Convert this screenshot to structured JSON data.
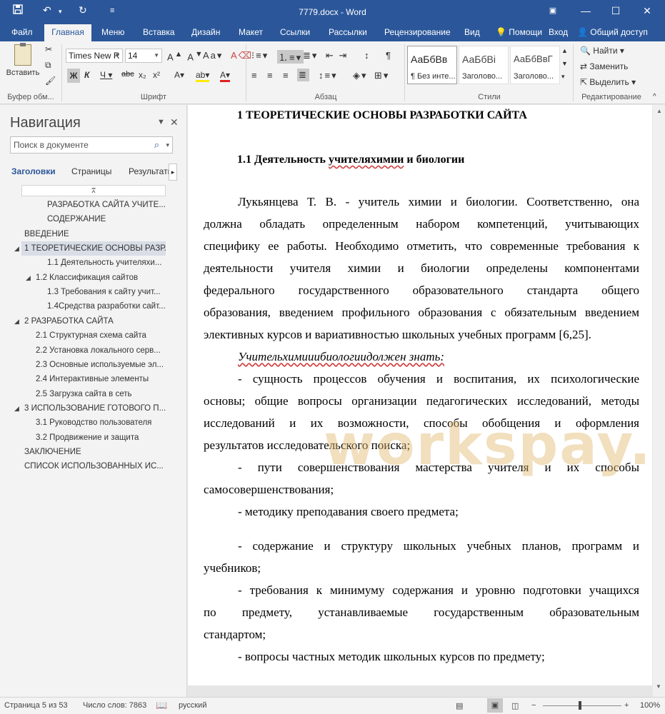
{
  "titlebar": {
    "title": "7779.docx - Word",
    "save_icon": "save-icon",
    "undo_icon": "undo-icon",
    "redo_icon": "redo-icon"
  },
  "tabs": {
    "items": [
      "Файл",
      "Главная",
      "Меню",
      "Вставка",
      "Дизайн",
      "Макет",
      "Ссылки",
      "Рассылки",
      "Рецензирование",
      "Вид"
    ],
    "active": "Главная",
    "help": "Помощи",
    "login": "Вход",
    "share": "Общий доступ"
  },
  "ribbon": {
    "paste_label": "Вставить",
    "clipboard_label": "Буфер обм...",
    "font_name": "Times New R",
    "font_size": "14",
    "font_group_label": "Шрифт",
    "paragraph_group_label": "Абзац",
    "styles_group_label": "Стили",
    "editing_group_label": "Редактирование",
    "styles": [
      {
        "sample": "АаБбВв",
        "name": "¶ Без инте..."
      },
      {
        "sample": "АаБбВі",
        "name": "Заголово..."
      },
      {
        "sample": "АаБбВвГ",
        "name": "Заголово..."
      }
    ],
    "find_label": "Найти",
    "replace_label": "Заменить",
    "select_label": "Выделить"
  },
  "nav": {
    "title": "Навигация",
    "search_placeholder": "Поиск в документе",
    "tabs": [
      "Заголовки",
      "Страницы",
      "Результаты"
    ],
    "items": [
      {
        "label": "РАЗРАБОТКА САЙТА УЧИТЕ...",
        "expanded": null
      },
      {
        "label": "СОДЕРЖАНИЕ",
        "expanded": null
      },
      {
        "label": "ВВЕДЕНИЕ",
        "expanded": null
      },
      {
        "label": "1 ТЕОРЕТИЧЕСКИЕ ОСНОВЫ РАЗР...",
        "expanded": true,
        "selected": true
      },
      {
        "label": "1.1 Деятельность учителяхи...",
        "expanded": null
      },
      {
        "label": "1.2 Классификация сайтов",
        "expanded": true
      },
      {
        "label": "1.3 Требования к сайту учит...",
        "expanded": null
      },
      {
        "label": "1.4Средства разработки сайт...",
        "expanded": null
      },
      {
        "label": "2 РАЗРАБОТКА САЙТА",
        "expanded": true
      },
      {
        "label": "2.1 Структурная схема сайта",
        "expanded": null
      },
      {
        "label": "2.2 Установка локального серв...",
        "expanded": null
      },
      {
        "label": "2.3 Основные используемые эл...",
        "expanded": null
      },
      {
        "label": "2.4 Интерактивные элементы",
        "expanded": null
      },
      {
        "label": "2.5 Загрузка сайта в сеть",
        "expanded": null
      },
      {
        "label": "3 ИСПОЛЬЗОВАНИЕ ГОТОВОГО П...",
        "expanded": true
      },
      {
        "label": "3.1 Руководство пользователя",
        "expanded": null
      },
      {
        "label": "3.2 Продвижение и защита",
        "expanded": null
      },
      {
        "label": "ЗАКЛЮЧЕНИЕ",
        "expanded": null
      },
      {
        "label": "СПИСОК ИСПОЛЬЗОВАННЫХ ИС...",
        "expanded": null
      }
    ]
  },
  "document": {
    "heading1": "1  ТЕОРЕТИЧЕСКИЕ ОСНОВЫ РАЗРАБОТКИ САЙТА",
    "heading2_prefix": "1.1  Деятельность ",
    "heading2_wavy": "учителяхимии",
    "heading2_suffix": " и биологии",
    "lines": [
      "Лукьянцева Т. В. - учитель химии и биологии. Соответственно, она",
      "должна обладать определенным набором компетенций, учитывающих",
      "специфику ее работы. Необходимо отметить, что современные требования к",
      "деятельности учителя химии и биологии определены компонентами",
      "федерального государственного образовательного стандарта общего",
      "образования, введением профильного образования с обязательным введением",
      "элективных курсов и вариативностью школьных учебных программ [6,25]."
    ],
    "italic_line": "Учительхимииибиологиидолжен знать:",
    "bullets": [
      "-  сущность процессов обучения и воспитания, их психологические",
      "основы; общие вопросы организации педагогических исследований, методы",
      "исследований и их возможности, способы обобщения и оформления",
      "результатов исследовательского поиска;",
      "-  пути совершенствования мастерства учителя и их способы",
      "самосовершенствования;",
      "-   методику преподавания своего предмета;",
      "-  содержание и структуру школьных учебных планов, программ и",
      "учебников;",
      "-  требования к минимуму содержания и уровню подготовки учащихся",
      "по предмету, устанавливаемые государственным образовательным",
      "стандартом;",
      "-   вопросы частных методик школьных курсов по предмету;"
    ],
    "watermark": "workspay.ru"
  },
  "status": {
    "page": "Страница 5 из 53",
    "words": "Число слов: 7863",
    "language": "русский",
    "zoom": "100%"
  }
}
